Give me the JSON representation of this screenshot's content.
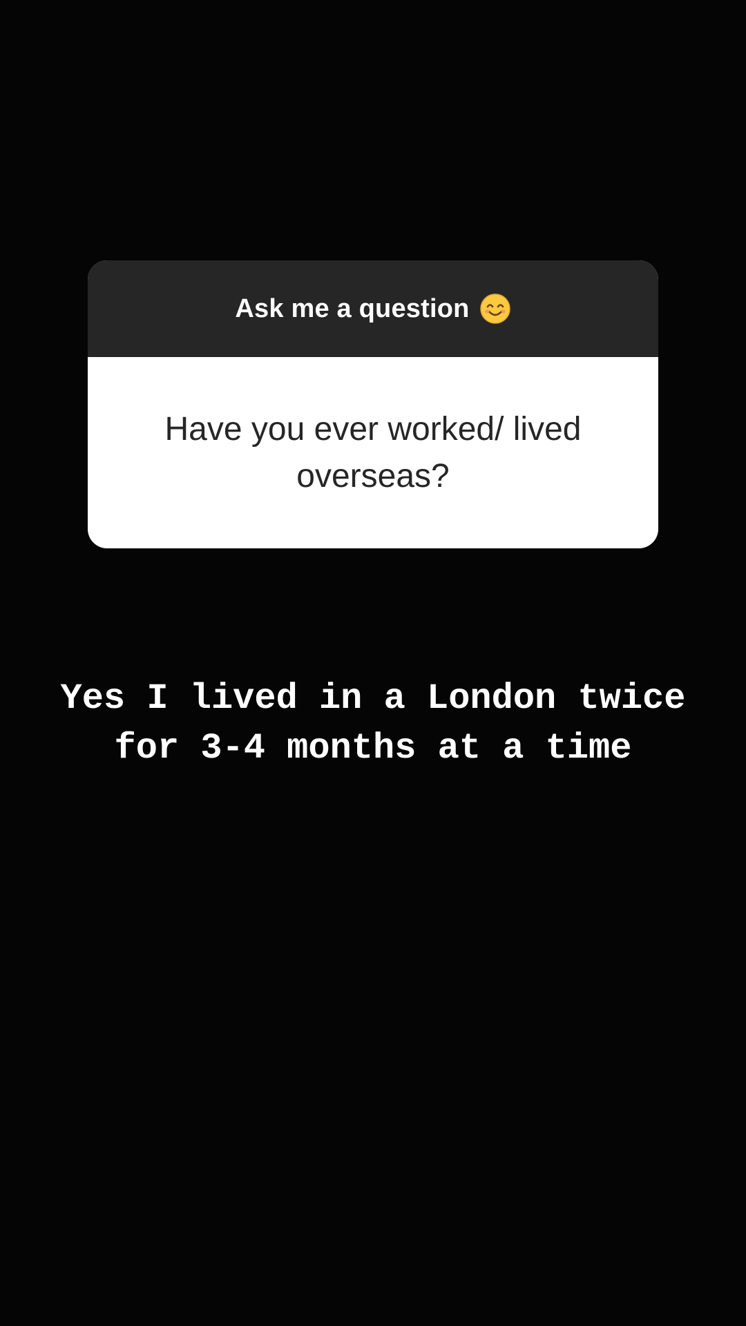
{
  "question_sticker": {
    "header": "Ask me a question",
    "header_icon": "smiling-face-icon",
    "question": "Have you ever worked/ lived overseas?"
  },
  "answer": {
    "text": "Yes I lived in a London twice for 3-4 months at a time"
  },
  "colors": {
    "background": "#050505",
    "header_bg": "#262626",
    "card_bg": "#ffffff",
    "emoji": "#f9c940"
  }
}
